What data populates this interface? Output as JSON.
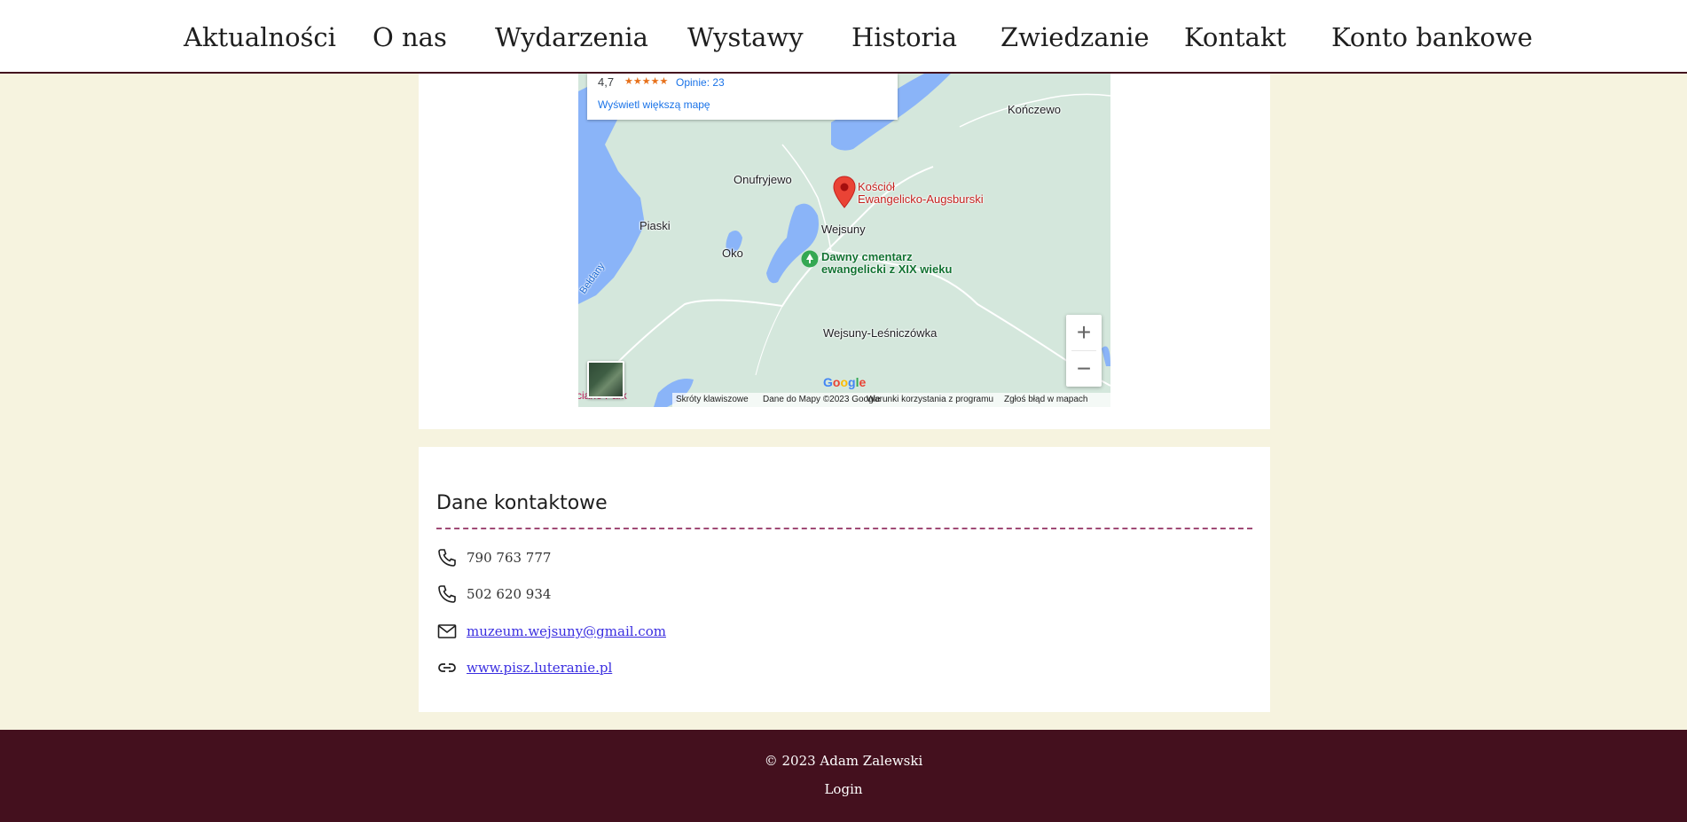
{
  "nav": {
    "items": [
      {
        "label": "Aktualności"
      },
      {
        "label": "O nas"
      },
      {
        "label": "Wydarzenia"
      },
      {
        "label": "Wystawy"
      },
      {
        "label": "Historia"
      },
      {
        "label": "Zwiedzanie"
      },
      {
        "label": "Kontakt"
      },
      {
        "label": "Konto bankowe"
      }
    ]
  },
  "map": {
    "popup": {
      "rating": "4,7",
      "stars": "★★★★★",
      "reviews": "Opinie: 23",
      "bigger_map": "Wyświetl większą mapę"
    },
    "labels": {
      "koncewo": "Kończewo",
      "onufryjewo": "Onufryjewo",
      "piaski": "Piaski",
      "oko": "Oko",
      "wejsuny": "Wejsuny",
      "wejsuny_lesniczowka": "Wejsuny-Leśniczówka",
      "beldany": "Bełdany",
      "corner": "ciane Park"
    },
    "poi_church": {
      "line1": "Kościół",
      "line2": "Ewangelicko-Augsburski"
    },
    "poi_cemetery": {
      "line1": "Dawny cmentarz",
      "line2": "ewangelicki z XIX wieku"
    },
    "zoom_in": "+",
    "zoom_out": "−",
    "google": "Google",
    "footer": {
      "shortcuts": "Skróty klawiszowe",
      "map_data": "Dane do Mapy ©2023 Google",
      "terms": "Warunki korzystania z programu",
      "report": "Zgłoś błąd w mapach"
    }
  },
  "contact": {
    "title": "Dane kontaktowe",
    "phone1": "790 763 777",
    "phone2": "502 620 934",
    "email": "muzeum.wejsuny@gmail.com",
    "website": "www.pisz.luteranie.pl"
  },
  "footer": {
    "copyright": "© 2023 Adam Zalewski",
    "login": "Login"
  },
  "colors": {
    "page_bg": "#f6f3df",
    "footer_bg": "#44101e",
    "accent_dashed": "#a04b76",
    "link": "#3a2ee0"
  }
}
